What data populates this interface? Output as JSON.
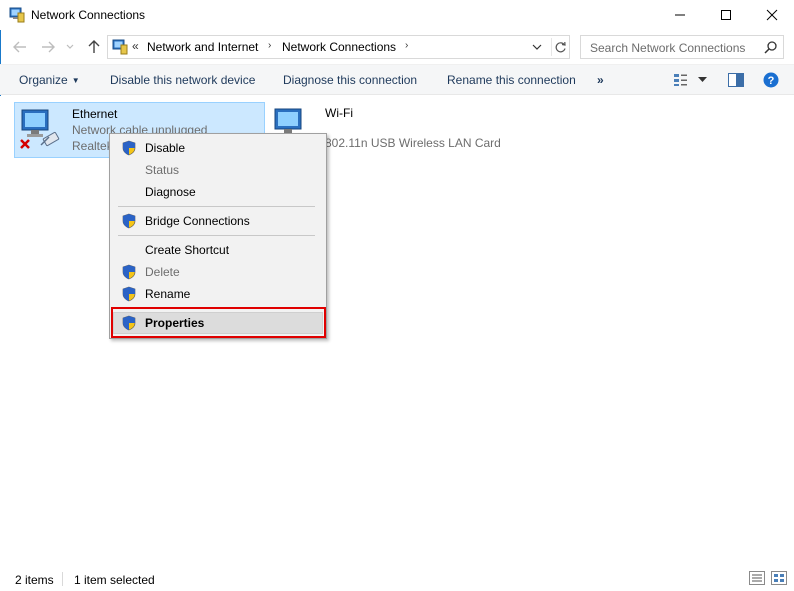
{
  "window": {
    "title": "Network Connections"
  },
  "address": {
    "overflow": "«",
    "crumbs": [
      "Network and Internet",
      "Network Connections"
    ],
    "search_placeholder": "Search Network Connections"
  },
  "toolbar": {
    "organize": "Organize",
    "disable": "Disable this network device",
    "diagnose": "Diagnose this connection",
    "rename": "Rename this connection",
    "more": "»"
  },
  "items": [
    {
      "name": "Ethernet",
      "status": "Network cable unplugged",
      "device": "Realtek"
    },
    {
      "name": "Wi-Fi",
      "device": "802.11n USB Wireless LAN Card"
    }
  ],
  "context_menu": {
    "disable": "Disable",
    "status": "Status",
    "diagnose": "Diagnose",
    "bridge": "Bridge Connections",
    "shortcut": "Create Shortcut",
    "delete": "Delete",
    "rename": "Rename",
    "properties": "Properties"
  },
  "statusbar": {
    "count": "2 items",
    "selected": "1 item selected"
  },
  "colors": {
    "selection": "#cce8ff",
    "highlight_box": "#e00000",
    "accent": "#1979ca"
  }
}
